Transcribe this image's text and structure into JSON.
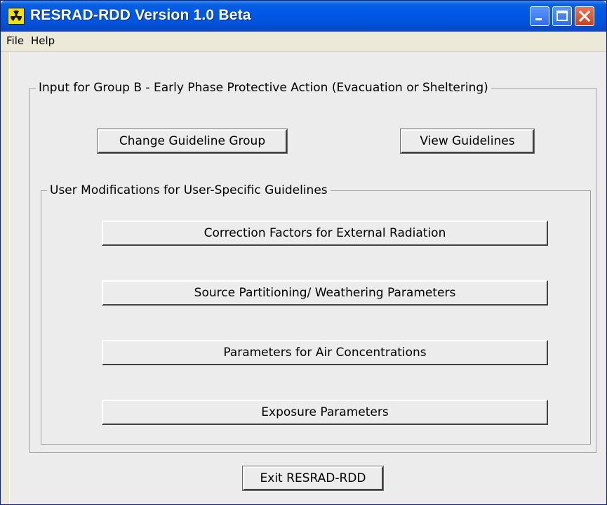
{
  "window": {
    "title": "RESRAD-RDD Version 1.0 Beta",
    "icon": "radiation-icon",
    "controls": [
      "minimize-icon",
      "maximize-icon",
      "close-icon"
    ]
  },
  "menu": {
    "file": "File",
    "help": "Help"
  },
  "main_group": {
    "legend": "Input for Group B - Early Phase Protective Action (Evacuation or Sheltering)",
    "change_guideline_group": "Change Guideline Group",
    "view_guidelines": "View Guidelines"
  },
  "user_mods": {
    "legend": "User Modifications for User-Specific Guidelines",
    "correction_factors": "Correction Factors for External Radiation",
    "source_partitioning": "Source Partitioning/ Weathering Parameters",
    "air_concentrations": "Parameters for Air Concentrations",
    "exposure_parameters": "Exposure Parameters"
  },
  "exit_button": "Exit RESRAD-RDD",
  "colors": {
    "titlebar": "#0054dc",
    "dialog_bg": "#ececec",
    "icon_yellow": "#f6e200"
  }
}
